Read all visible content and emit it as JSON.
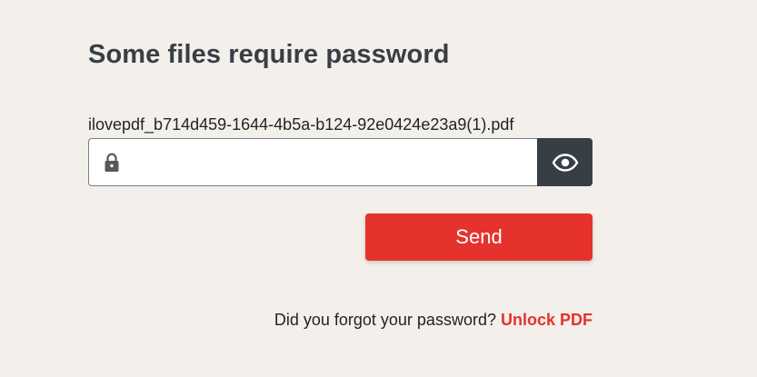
{
  "dialog": {
    "title": "Some files require password",
    "file_name": "ilovepdf_b714d459-1644-4b5a-b124-92e0424e23a9(1).pdf",
    "password_value": "",
    "send_label": "Send",
    "forgot_text": "Did you forgot your password?",
    "unlock_link": "Unlock PDF"
  },
  "icons": {
    "lock": "lock-icon",
    "toggle_visibility": "eye-icon"
  },
  "colors": {
    "background": "#f3efeb",
    "accent": "#e5322d",
    "dark": "#383e45"
  }
}
